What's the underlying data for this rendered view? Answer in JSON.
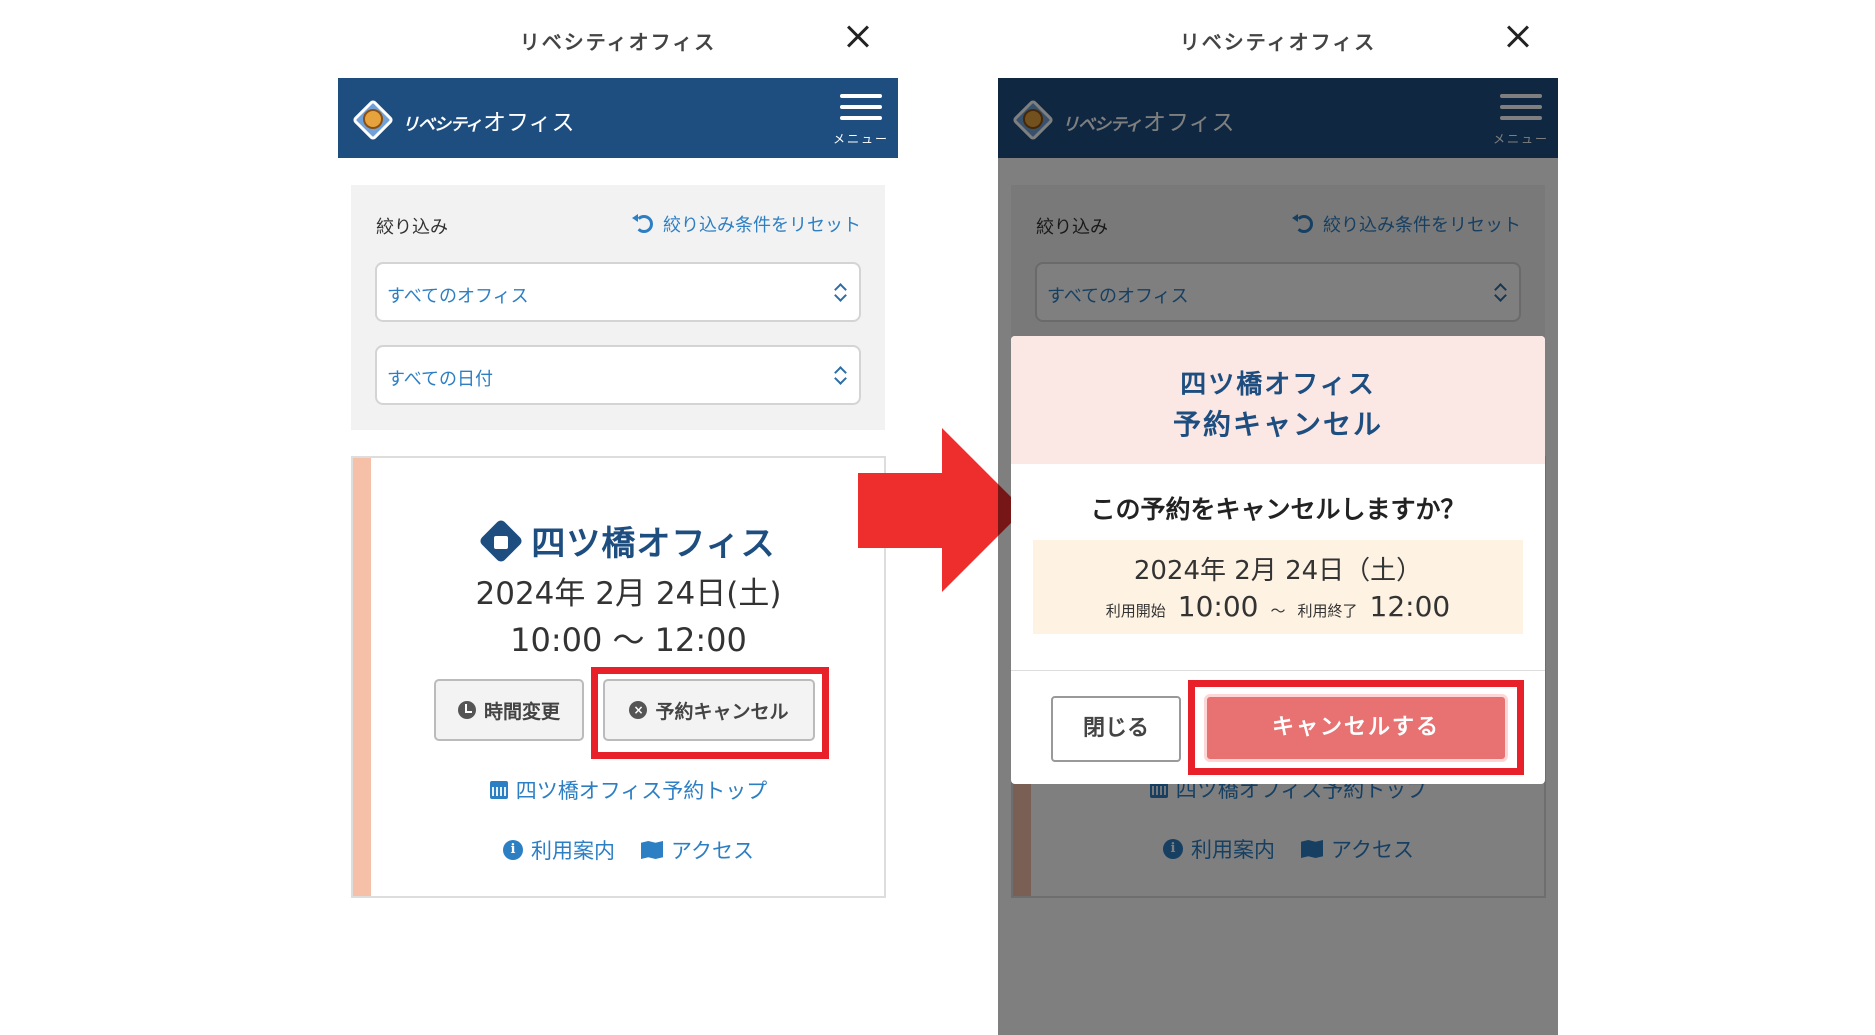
{
  "window": {
    "title": "リベシティオフィス"
  },
  "logo": {
    "text_a": "リベシティ",
    "text_b": "オフィス"
  },
  "menu": {
    "label": "メニュー"
  },
  "filter": {
    "label": "絞り込み",
    "reset": "絞り込み条件をリセット",
    "office_select": "すべてのオフィス",
    "date_select": "すべての日付"
  },
  "reservation": {
    "office": "四ツ橋オフィス",
    "date": "2024年 2月 24日(土)",
    "time": "10:00 〜 12:00",
    "change_button": "時間変更",
    "cancel_button": "予約キャンセル",
    "top_link": "四ツ橋オフィス予約トップ",
    "guide_link": "利用案内",
    "access_link": "アクセス"
  },
  "modal": {
    "title_office": "四ツ橋オフィス",
    "title_action": "予約キャンセル",
    "question": "この予約をキャンセルしますか？",
    "date": "2024年 2月 24日（土）",
    "start_label": "利用開始",
    "start_time": "10:00",
    "tilde": "〜",
    "end_label": "利用終了",
    "end_time": "12:00",
    "close_button": "閉じる",
    "confirm_button": "キャンセルする"
  },
  "colors": {
    "brand_navy": "#1e4e80",
    "link_blue": "#2d7fc4",
    "highlight_red": "#e8202a",
    "arrow_red": "#ee2d2d",
    "confirm_button": "#e87272"
  }
}
